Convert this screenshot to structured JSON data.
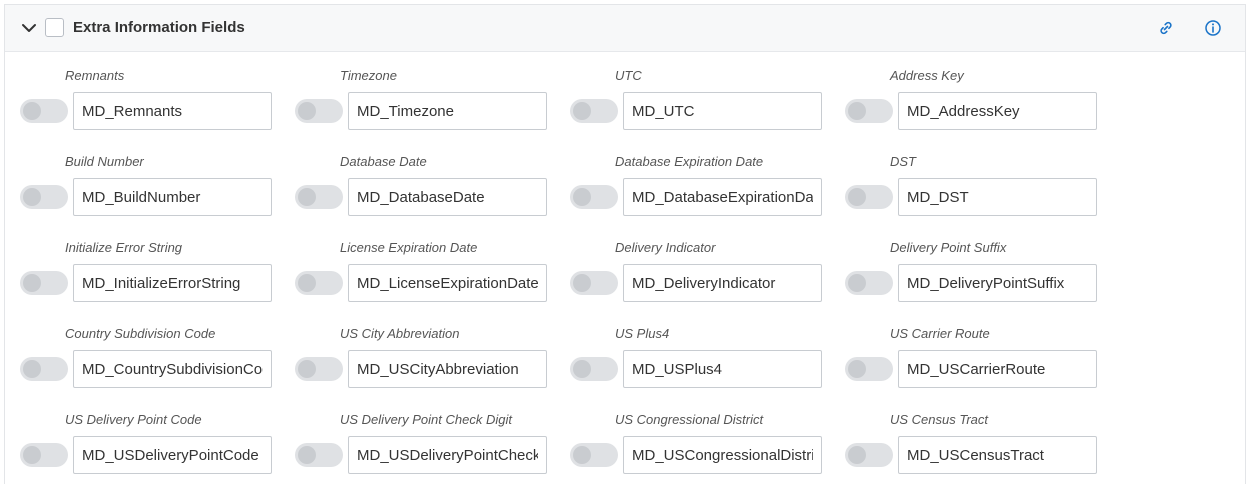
{
  "section": {
    "title": "Extra Information Fields"
  },
  "fields": [
    {
      "label": "Remnants",
      "value": "MD_Remnants"
    },
    {
      "label": "Timezone",
      "value": "MD_Timezone"
    },
    {
      "label": "UTC",
      "value": "MD_UTC"
    },
    {
      "label": "Address Key",
      "value": "MD_AddressKey"
    },
    {
      "label": "Build Number",
      "value": "MD_BuildNumber"
    },
    {
      "label": "Database Date",
      "value": "MD_DatabaseDate"
    },
    {
      "label": "Database Expiration Date",
      "value": "MD_DatabaseExpirationDate"
    },
    {
      "label": "DST",
      "value": "MD_DST"
    },
    {
      "label": "Initialize Error String",
      "value": "MD_InitializeErrorString"
    },
    {
      "label": "License Expiration Date",
      "value": "MD_LicenseExpirationDate"
    },
    {
      "label": "Delivery Indicator",
      "value": "MD_DeliveryIndicator"
    },
    {
      "label": "Delivery Point Suffix",
      "value": "MD_DeliveryPointSuffix"
    },
    {
      "label": "Country Subdivision Code",
      "value": "MD_CountrySubdivisionCode"
    },
    {
      "label": "US City Abbreviation",
      "value": "MD_USCityAbbreviation"
    },
    {
      "label": "US Plus4",
      "value": "MD_USPlus4"
    },
    {
      "label": "US Carrier Route",
      "value": "MD_USCarrierRoute"
    },
    {
      "label": "US Delivery Point Code",
      "value": "MD_USDeliveryPointCode"
    },
    {
      "label": "US Delivery Point Check Digit",
      "value": "MD_USDeliveryPointCheckDigit"
    },
    {
      "label": "US Congressional District",
      "value": "MD_USCongressionalDistrict"
    },
    {
      "label": "US Census Tract",
      "value": "MD_USCensusTract"
    }
  ],
  "icons": {
    "collapse": "chevron-down-icon",
    "link": "link-icon",
    "info": "info-icon"
  },
  "colors": {
    "accent": "#1a73c8",
    "toggle_off": "#dfe1e4"
  }
}
